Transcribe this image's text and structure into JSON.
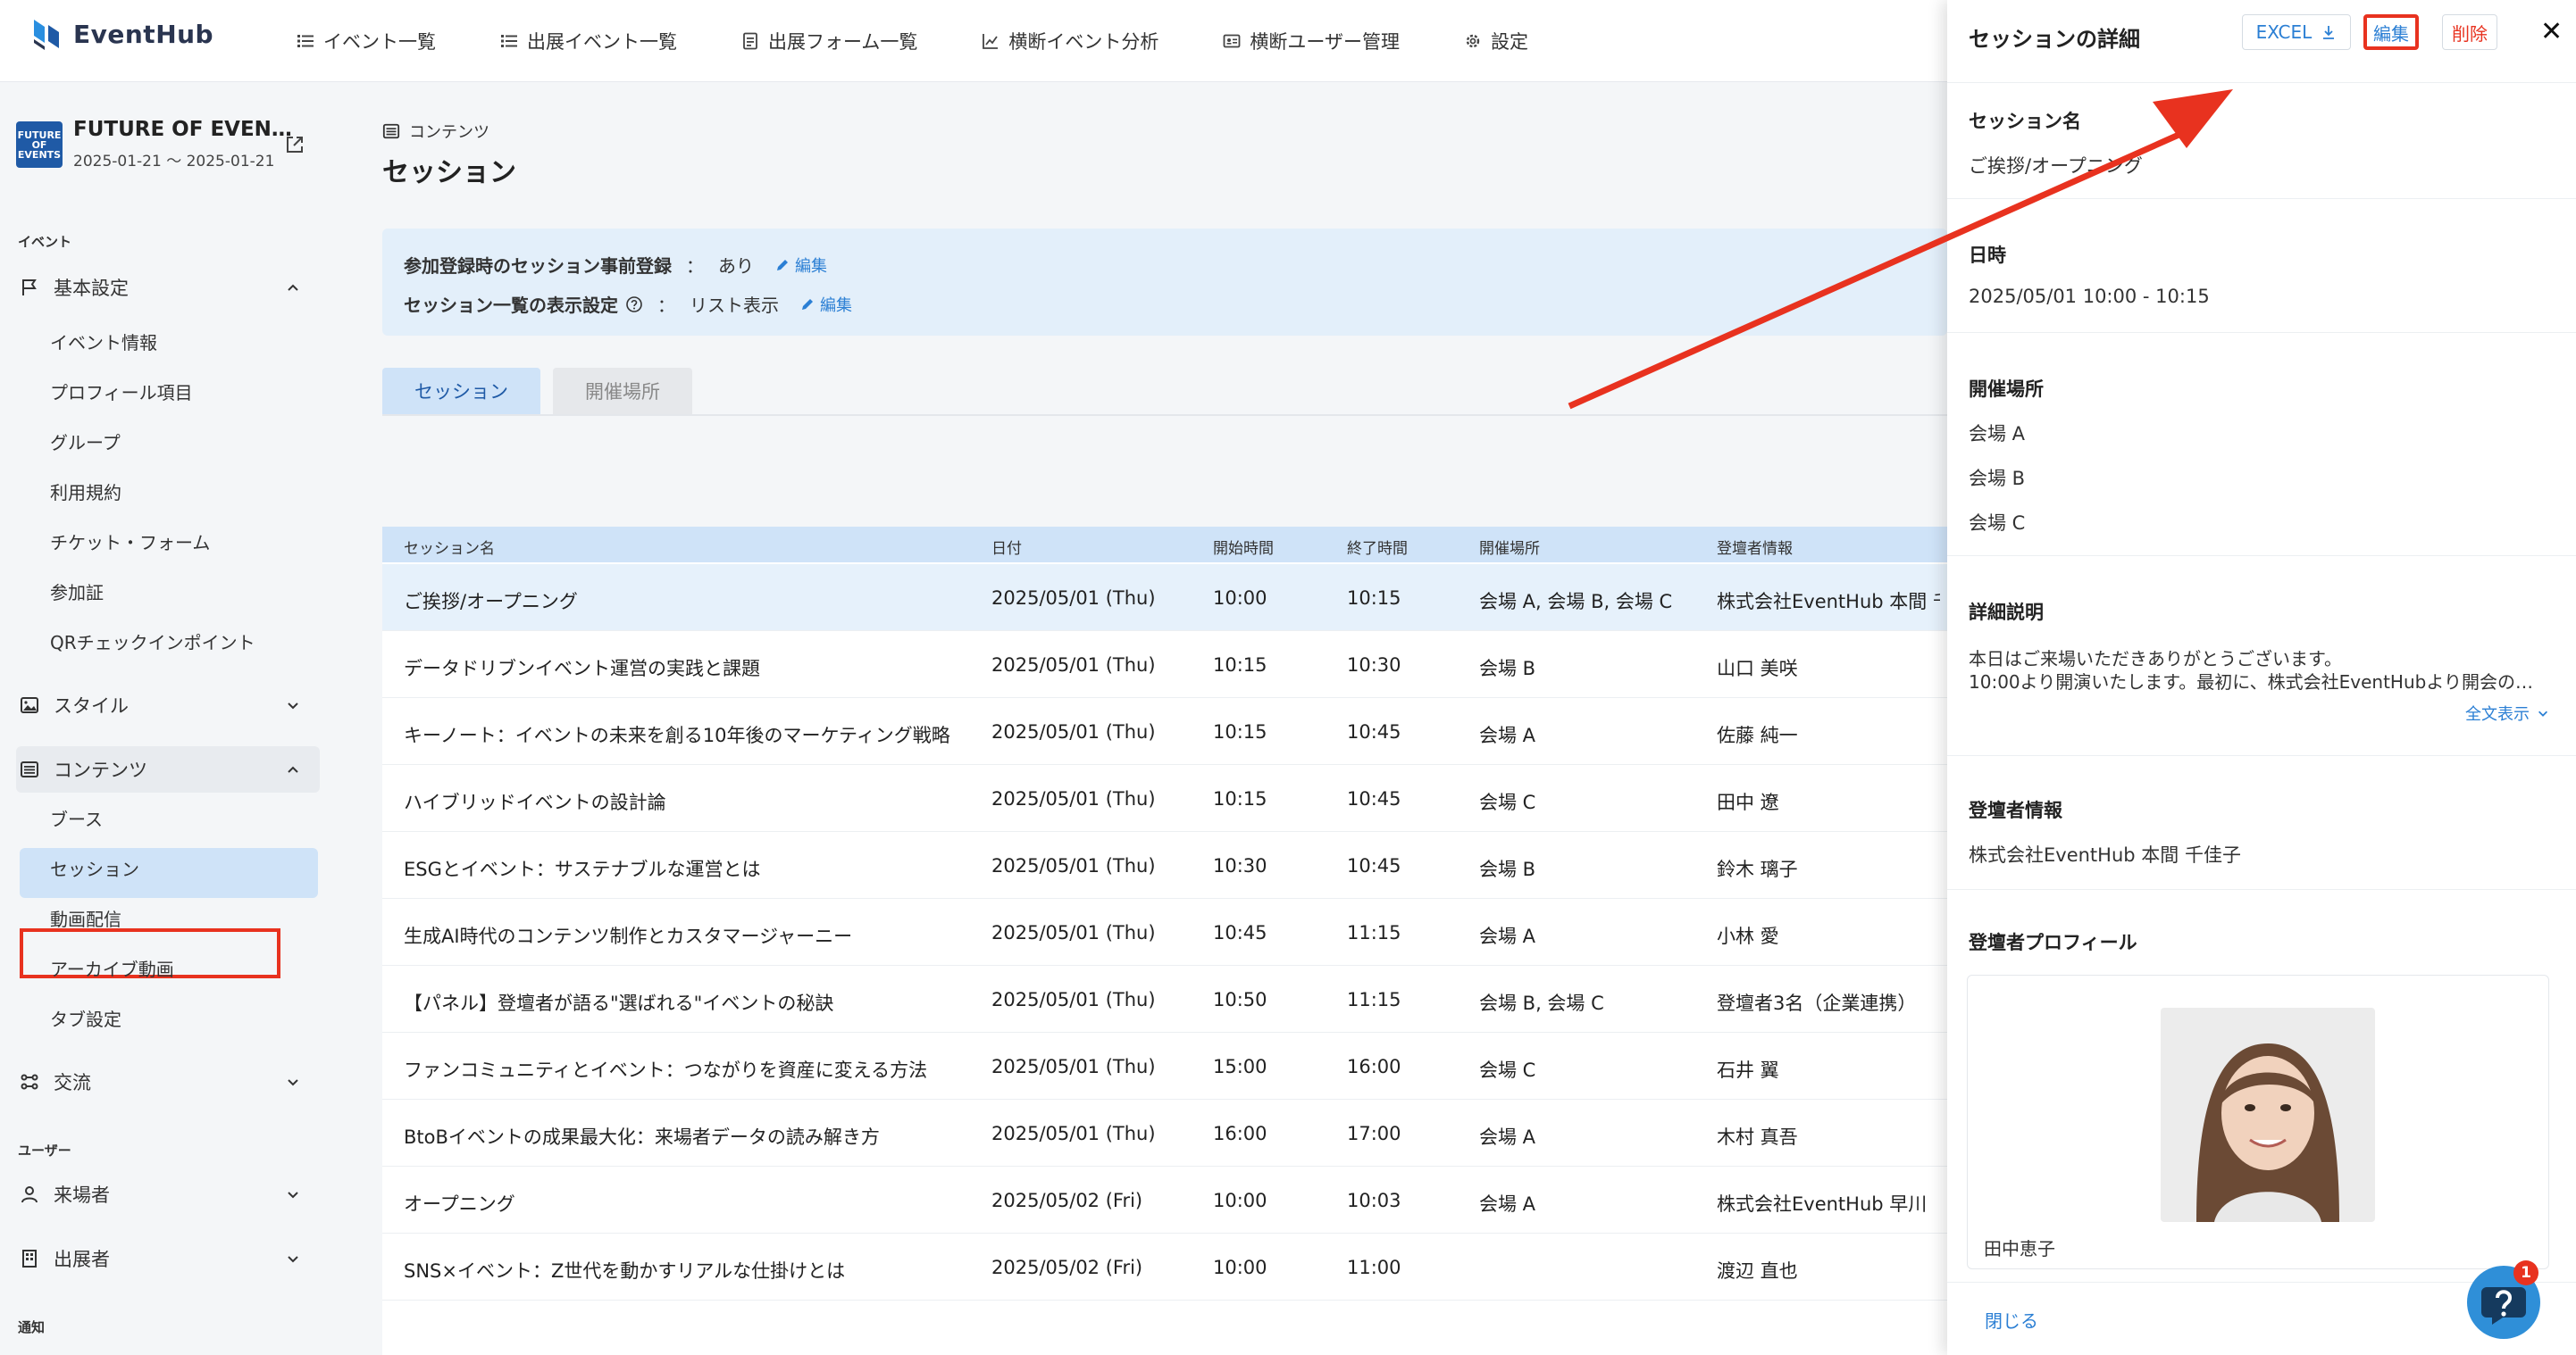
{
  "brand": {
    "name": "EventHub"
  },
  "nav": [
    {
      "label": "イベント一覧",
      "icon": "list-icon"
    },
    {
      "label": "出展イベント一覧",
      "icon": "list-icon"
    },
    {
      "label": "出展フォーム一覧",
      "icon": "form-icon"
    },
    {
      "label": "横断イベント分析",
      "icon": "chart-icon"
    },
    {
      "label": "横断ユーザー管理",
      "icon": "id-card-icon"
    },
    {
      "label": "設定",
      "icon": "gear-icon"
    }
  ],
  "event": {
    "thumb": "FUTURE OF EVENTS",
    "title": "FUTURE OF EVEN…",
    "dates": "2025-01-21 〜 2025-01-21"
  },
  "sidebar": {
    "section_event": "イベント",
    "basic": "基本設定",
    "basic_items": [
      "イベント情報",
      "プロフィール項目",
      "グループ",
      "利用規約",
      "チケット・フォーム",
      "参加証",
      "QRチェックインポイント"
    ],
    "style": "スタイル",
    "content": "コンテンツ",
    "content_items": [
      "ブース",
      "セッション",
      "動画配信",
      "アーカイブ動画",
      "タブ設定"
    ],
    "exchange": "交流",
    "section_user": "ユーザー",
    "visitors": "来場者",
    "exhibitors": "出展者",
    "section_notify": "通知"
  },
  "main": {
    "breadcrumb": "コンテンツ",
    "title": "セッション",
    "info": [
      {
        "key": "参加登録時のセッション事前登録",
        "value": "あり",
        "edit": "編集"
      },
      {
        "key": "セッション一覧の表示設定",
        "value": "リスト表示",
        "edit": "編集"
      }
    ],
    "tabs": [
      "セッション",
      "開催場所"
    ]
  },
  "table": {
    "headers": [
      "セッション名",
      "日付",
      "開始時間",
      "終了時間",
      "開催場所",
      "登壇者情報"
    ],
    "rows": [
      [
        "ご挨拶/オープニング",
        "2025/05/01 (Thu)",
        "10:00",
        "10:15",
        "会場 A, 会場 B, 会場 C",
        "株式会社EventHub 本間 千"
      ],
      [
        "データドリブンイベント運営の実践と課題",
        "2025/05/01 (Thu)",
        "10:15",
        "10:30",
        "会場 B",
        "山口 美咲"
      ],
      [
        "キーノート：イベントの未来を創る10年後のマーケティング戦略",
        "2025/05/01 (Thu)",
        "10:15",
        "10:45",
        "会場 A",
        "佐藤 純一"
      ],
      [
        "ハイブリッドイベントの設計論",
        "2025/05/01 (Thu)",
        "10:15",
        "10:45",
        "会場 C",
        "田中 遼"
      ],
      [
        "ESGとイベント：サステナブルな運営とは",
        "2025/05/01 (Thu)",
        "10:30",
        "10:45",
        "会場 B",
        "鈴木 璃子"
      ],
      [
        "生成AI時代のコンテンツ制作とカスタマージャーニー",
        "2025/05/01 (Thu)",
        "10:45",
        "11:15",
        "会場 A",
        "小林 愛"
      ],
      [
        "【パネル】登壇者が語る\"選ばれる\"イベントの秘訣",
        "2025/05/01 (Thu)",
        "10:50",
        "11:15",
        "会場 B, 会場 C",
        "登壇者3名（企業連携）"
      ],
      [
        "ファンコミュニティとイベント：つながりを資産に変える方法",
        "2025/05/01 (Thu)",
        "15:00",
        "16:00",
        "会場 C",
        "石井 翼"
      ],
      [
        "BtoBイベントの成果最大化：来場者データの読み解き方",
        "2025/05/01 (Thu)",
        "16:00",
        "17:00",
        "会場 A",
        "木村 真吾"
      ],
      [
        "オープニング",
        "2025/05/02 (Fri)",
        "10:00",
        "10:03",
        "会場 A",
        "株式会社EventHub 早川 "
      ],
      [
        "SNS×イベント：Z世代を動かすリアルな仕掛けとは",
        "2025/05/02 (Fri)",
        "10:00",
        "11:00",
        "",
        "渡辺 直也"
      ]
    ]
  },
  "drawer": {
    "title": "セッションの詳細",
    "excel": "EXCEL",
    "edit": "編集",
    "delete": "削除",
    "name_label": "セッション名",
    "name": "ご挨拶/オープニング",
    "datetime_label": "日時",
    "datetime": "2025/05/01 10:00 - 10:15",
    "venue_label": "開催場所",
    "venues": [
      "会場 A",
      "会場 B",
      "会場 C"
    ],
    "desc_label": "詳細説明",
    "desc_line1": "本日はご来場いただきありがとうございます。",
    "desc_line2": "10:00より開演いたします。最初に、株式会社EventHubより開会の…",
    "show_all": "全文表示",
    "speaker_label": "登壇者情報",
    "speaker": "株式会社EventHub 本間 千佳子",
    "profile_label": "登壇者プロフィール",
    "profile_name": "田中恵子",
    "close": "閉じる"
  },
  "help": {
    "badge": "1"
  },
  "colors": {
    "accent": "#2b7fd4",
    "highlight": "#cfe3f8",
    "annotation": "#e8321f",
    "delete": "#e8321f"
  }
}
